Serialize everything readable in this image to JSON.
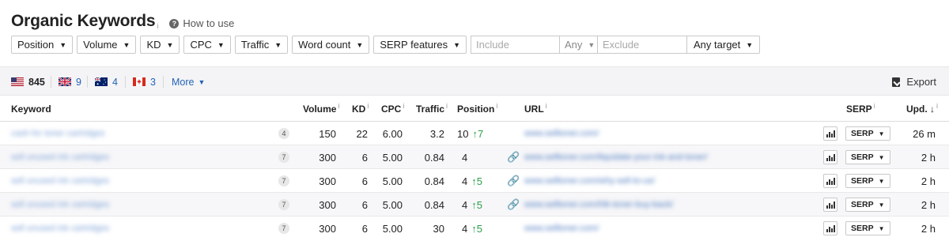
{
  "header": {
    "title": "Organic Keywords",
    "info_mark": "i",
    "how_to": "How to use"
  },
  "filters": {
    "position": "Position",
    "volume": "Volume",
    "kd": "KD",
    "cpc": "CPC",
    "traffic": "Traffic",
    "word_count": "Word count",
    "serp_features": "SERP features",
    "include_placeholder": "Include",
    "any": "Any",
    "exclude_placeholder": "Exclude",
    "any_target": "Any target"
  },
  "countries": [
    {
      "flag": "us-flag",
      "count": "845"
    },
    {
      "flag": "uk-flag",
      "count": "9"
    },
    {
      "flag": "au-flag",
      "count": "4"
    },
    {
      "flag": "ca-flag",
      "count": "3"
    }
  ],
  "more_label": "More",
  "export_label": "Export",
  "columns": {
    "keyword": "Keyword",
    "volume": "Volume",
    "kd": "KD",
    "cpc": "CPC",
    "traffic": "Traffic",
    "position": "Position",
    "url": "URL",
    "serp": "SERP",
    "upd": "Upd. ↓"
  },
  "rows": [
    {
      "keyword": "cash for toner cartridges",
      "badge": "4",
      "volume": "150",
      "kd": "22",
      "cpc": "6.00",
      "traffic": "3.2",
      "position": "10",
      "change": "↑7",
      "has_link": false,
      "url": "www.selltoner.com/",
      "serp": "SERP",
      "upd": "26 m"
    },
    {
      "keyword": "sell unused ink cartridges",
      "badge": "7",
      "volume": "300",
      "kd": "6",
      "cpc": "5.00",
      "traffic": "0.84",
      "position": "4",
      "change": "",
      "has_link": true,
      "url": "www.selltoner.com/liquidate-your-ink-and-toner/",
      "serp": "SERP",
      "upd": "2 h"
    },
    {
      "keyword": "sell unused ink cartridges",
      "badge": "7",
      "volume": "300",
      "kd": "6",
      "cpc": "5.00",
      "traffic": "0.84",
      "position": "4",
      "change": "↑5",
      "has_link": true,
      "url": "www.selltoner.com/why-sell-to-us/",
      "serp": "SERP",
      "upd": "2 h"
    },
    {
      "keyword": "sell unused ink cartridges",
      "badge": "7",
      "volume": "300",
      "kd": "6",
      "cpc": "5.00",
      "traffic": "0.84",
      "position": "4",
      "change": "↑5",
      "has_link": true,
      "url": "www.selltoner.com/hlk-toner-buy-back/",
      "serp": "SERP",
      "upd": "2 h"
    },
    {
      "keyword": "sell unused ink cartridges",
      "badge": "7",
      "volume": "300",
      "kd": "6",
      "cpc": "5.00",
      "traffic": "30",
      "position": "4",
      "change": "↑5",
      "has_link": false,
      "url": "www.selltoner.com/",
      "serp": "SERP",
      "upd": "2 h"
    }
  ]
}
